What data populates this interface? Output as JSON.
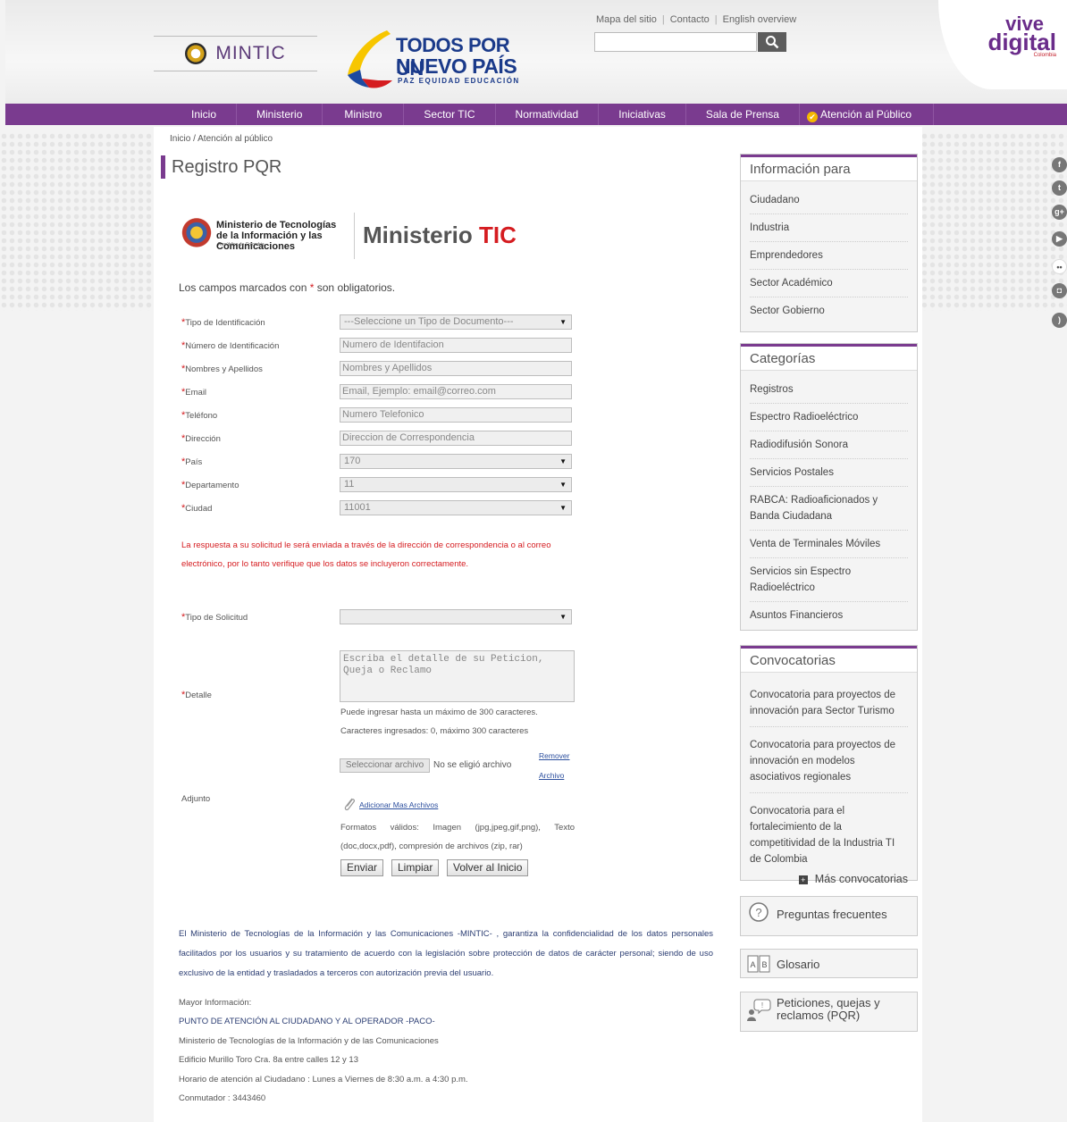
{
  "header": {
    "mintic": "MINTIC",
    "gov_line1": "TODOS POR UN",
    "gov_line2": "NUEVO PAÍS",
    "gov_line3": "PAZ EQUIDAD EDUCACIÓN",
    "top_links": [
      "Mapa del sitio",
      "Contacto",
      "English overview"
    ],
    "search_placeholder": "",
    "vive1": "vive",
    "vive2": "digital",
    "vive3": "Colombia"
  },
  "nav": [
    "Inicio",
    "Ministerio",
    "Ministro",
    "Sector TIC",
    "Normatividad",
    "Iniciativas",
    "Sala de Prensa",
    "Atención al Público"
  ],
  "breadcrumb": "Inicio / Atención al público",
  "page_title": "Registro PQR",
  "ministry_logo": {
    "line1": "Ministerio de Tecnologías de la Información y las Comunicaciones",
    "line2": "República de Colombia",
    "big": "Ministerio",
    "big_red": "TIC"
  },
  "required_note": {
    "before": "Los campos marcados con ",
    "star": "*",
    "after": " son obligatorios."
  },
  "form": {
    "tipo_id_label": "Tipo de Identificación",
    "tipo_id_value": "---Seleccione un Tipo de Documento---",
    "num_id_label": "Número de Identificación",
    "num_id_placeholder": "Numero de Identifacion",
    "nombres_label": "Nombres y Apellidos",
    "nombres_placeholder": "Nombres y Apellidos",
    "email_label": "Email",
    "email_placeholder": "Email, Ejemplo: email@correo.com",
    "telefono_label": "Teléfono",
    "telefono_placeholder": "Numero Telefonico",
    "direccion_label": "Dirección",
    "direccion_placeholder": "Direccion de Correspondencia",
    "pais_label": "País",
    "pais_value": "170",
    "depto_label": "Departamento",
    "depto_value": "11",
    "ciudad_label": "Ciudad",
    "ciudad_value": "11001",
    "warning": "La respuesta a su solicitud le será enviada a través de la dirección de correspondencia o al correo electrónico, por lo tanto verifique que los datos se incluyeron correctamente.",
    "tipo_sol_label": "Tipo de Solicitud",
    "tipo_sol_value": "",
    "detalle_label": "Detalle",
    "detalle_placeholder": "Escriba el detalle de su Peticion, Queja o Reclamo",
    "max_note": "Puede ingresar hasta un máximo de 300 caracteres.",
    "count_note": "Caracteres ingresados: 0, máximo 300 caracteres",
    "file_button": "Seleccionar archivo",
    "file_none": "No se eligió archivo",
    "remove1": "Remover",
    "remove2": "Archivo",
    "adjunto_label": "Adjunto",
    "add_more": "Adicionar Mas Archivos",
    "formats": "Formatos válidos: Imagen (jpg,jpeg,gif,png), Texto (doc,docx,pdf), compresión de archivos (zip, rar)",
    "btn_enviar": "Enviar",
    "btn_limpiar": "Limpiar",
    "btn_volver": "Volver al Inicio"
  },
  "privacy": "El Ministerio de Tecnologías de la Información y las Comunicaciones -MINTIC- , garantiza la confidencialidad de los datos personales facilitados por los usuarios y su tratamiento de acuerdo con la legislación sobre protección de datos de carácter personal; siendo de uso exclusivo de la entidad y trasladados a terceros con autorización previa del usuario.",
  "info": {
    "mayor": "Mayor Información:",
    "paco": "PUNTO DE ATENCIÓN AL CIUDADANO Y AL OPERADOR -PACO-",
    "ministerio": "Ministerio de Tecnologías de la Información y de las Comunicaciones",
    "edificio": "Edificio Murillo Toro Cra. 8a entre calles 12 y 13",
    "horario": "Horario de atención al Ciudadano : Lunes a Viernes de 8:30 a.m. a 4:30 p.m.",
    "conmutador": "Conmutador : 3443460"
  },
  "sidebar": {
    "info_title": "Información para",
    "info_items": [
      "Ciudadano",
      "Industria",
      "Emprendedores",
      "Sector Académico",
      "Sector Gobierno"
    ],
    "cat_title": "Categorías",
    "cat_items": [
      "Registros",
      "Espectro Radioeléctrico",
      "Radiodifusión Sonora",
      "Servicios Postales",
      "RABCA: Radioaficionados y Banda Ciudadana",
      "Venta de Terminales Móviles",
      "Servicios sin Espectro Radioeléctrico",
      "Asuntos Financieros"
    ],
    "conv_title": "Convocatorias",
    "conv_items": [
      "Convocatoria para proyectos de innovación para Sector Turismo",
      "Convocatoria para proyectos de innovación en modelos asociativos regionales",
      "Convocatoria para el fortalecimiento de la competitividad de la Industria TI de Colombia"
    ],
    "more_conv": "Más convocatorias",
    "faq": "Preguntas frecuentes",
    "glosario": "Glosario",
    "pqr": "Peticiones, quejas y reclamos (PQR)"
  },
  "social": [
    "facebook-icon",
    "twitter-icon",
    "google-plus-icon",
    "youtube-icon",
    "flickr-icon",
    "instagram-icon",
    "rss-icon"
  ]
}
